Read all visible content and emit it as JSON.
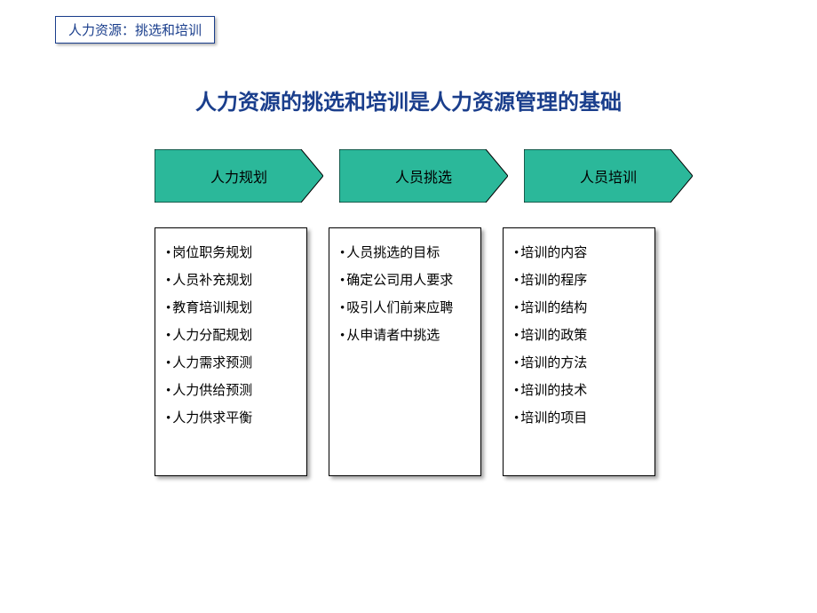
{
  "header": "人力资源：挑选和培训",
  "title": "人力资源的挑选和培训是人力资源管理的基础",
  "chevrons": [
    {
      "label": "人力规划"
    },
    {
      "label": "人员挑选"
    },
    {
      "label": "人员培训"
    }
  ],
  "columns": [
    {
      "items": [
        "岗位职务规划",
        "人员补充规划",
        "教育培训规划",
        "人力分配规划",
        "人力需求预测",
        "人力供给预测",
        "人力供求平衡"
      ]
    },
    {
      "items": [
        "人员挑选的目标",
        "确定公司用人要求",
        "吸引人们前来应聘",
        "从申请者中挑选"
      ]
    },
    {
      "items": [
        "培训的内容",
        "培训的程序",
        "培训的结构",
        "培训的政策",
        "培训的方法",
        "培训的技术",
        "培训的项目"
      ]
    }
  ],
  "colors": {
    "chevron_fill": "#2bb89a",
    "chevron_stroke": "#000000",
    "accent": "#1a3e8c"
  }
}
